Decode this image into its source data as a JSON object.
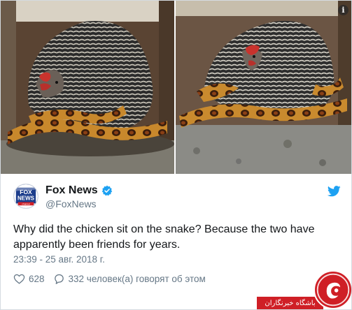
{
  "tweet": {
    "display_name": "Fox News",
    "screen_name": "@FoxNews",
    "text": "Why did the chicken sit on the snake? Because the two have apparently been friends for years.",
    "timestamp": "23:39 - 25 авг. 2018 г.",
    "likes": "628",
    "replies_text": "332 человек(а) говорят об этом",
    "avatar_logo": [
      "FOX",
      "NEWS",
      "channel"
    ]
  },
  "media": {
    "photo_count": 2,
    "info_label": "i"
  },
  "icons": {
    "avatar": "fox-news-logo",
    "verified": "verified-badge-icon",
    "platform": "twitter-bird-icon",
    "like": "heart-icon",
    "reply": "speech-bubble-icon",
    "info": "info-icon"
  },
  "watermark": {
    "text": "باشگاه خبرنگاران"
  },
  "colors": {
    "accent": "#1da1f2",
    "secondary_text": "#657786",
    "watermark": "#cf1f26"
  }
}
